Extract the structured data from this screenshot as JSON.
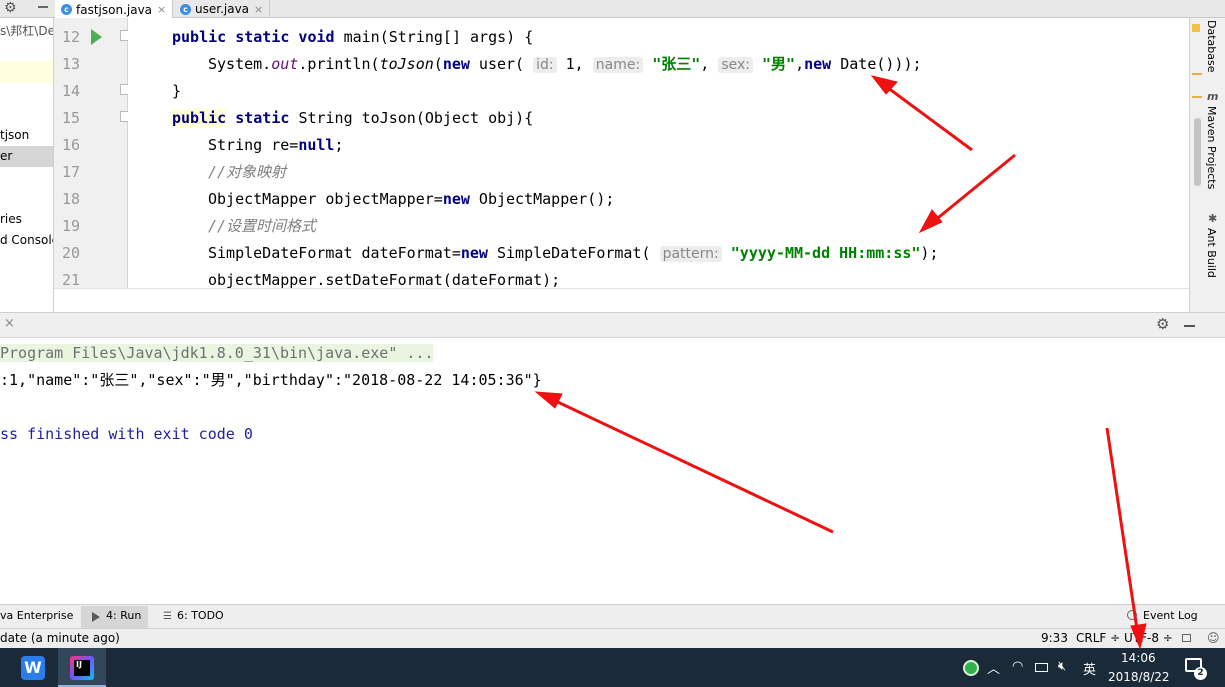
{
  "tabs": [
    {
      "label": "fastjson.java",
      "close": "×",
      "icon": "c-class-icon"
    },
    {
      "label": "user.java",
      "close": "×",
      "icon": "c-class-icon"
    }
  ],
  "project": {
    "path": "s\\邦杠\\De",
    "items": [
      "tjson",
      "er",
      "ries",
      "d Console"
    ]
  },
  "editor": {
    "lines": [
      {
        "n": "12"
      },
      {
        "n": "13"
      },
      {
        "n": "14"
      },
      {
        "n": "15"
      },
      {
        "n": "16"
      },
      {
        "n": "17"
      },
      {
        "n": "18"
      },
      {
        "n": "19"
      },
      {
        "n": "20"
      },
      {
        "n": "21"
      }
    ],
    "code": {
      "l12": {
        "a": "public static void ",
        "b": "main(String[] args) {"
      },
      "l13": {
        "a": "System.",
        "out": "out",
        "b": ".println(",
        "fn": "toJson",
        "c": "(",
        "new1": "new",
        "d": " user( ",
        "h1": "id:",
        "e": " 1, ",
        "h2": "name:",
        "s1": " \"张三\"",
        "f": ", ",
        "h3": "sex:",
        "s2": " \"男\"",
        "g": ",",
        "new2": "new",
        "h": " Date()));"
      },
      "l14": "}",
      "l15": {
        "kw1": "public",
        "kw2": " static ",
        "b": "String toJson(Object obj){"
      },
      "l16": {
        "a": "String re=",
        "kw": "null",
        "b": ";"
      },
      "l17": "//对象映射",
      "l18": {
        "a": "ObjectMapper objectMapper=",
        "kw": "new",
        "b": " ObjectMapper();"
      },
      "l19": "//设置时间格式",
      "l20": {
        "a": "SimpleDateFormat dateFormat=",
        "kw": "new",
        "b": " SimpleDateFormat( ",
        "hint": "pattern:",
        "str": " \"yyyy-MM-dd HH:mm:ss\"",
        "c": ");"
      },
      "l21": "objectMapper.setDateFormat(dateFormat);"
    }
  },
  "sidebar_right": [
    "Database",
    "Maven Projects",
    "Ant Build"
  ],
  "console": {
    "cmd": "Program Files\\Java\\jdk1.8.0_31\\bin\\java.exe\" ...",
    "output": ":1,\"name\":\"张三\",\"sex\":\"男\",\"birthday\":\"2018-08-22 14:05:36\"}",
    "exit": "ss finished with exit code 0"
  },
  "toolwindows": {
    "java_enterprise": "va Enterprise",
    "run": "4: Run",
    "todo": "6: TODO",
    "event_log": "Event Log"
  },
  "status": {
    "message": "date (a minute ago)",
    "position": "9:33",
    "line_sep": "CRLF ÷",
    "encoding": "UTF-8 ÷"
  },
  "taskbar": {
    "ime": "英",
    "time": "14:06",
    "date": "2018/8/22",
    "notifications": "2"
  },
  "colors": {
    "keyword": "#000080",
    "string": "#008000",
    "comment": "#808080",
    "arrow": "#ee1111",
    "taskbar": "#1b2a38"
  }
}
